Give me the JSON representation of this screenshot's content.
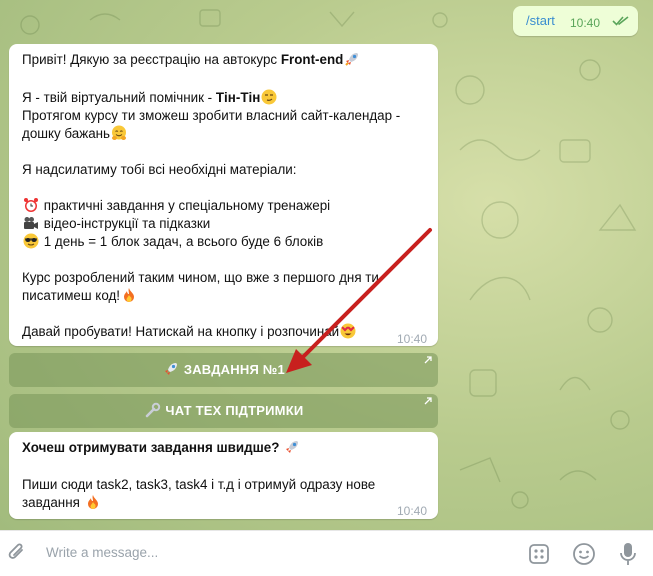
{
  "outgoing": {
    "text": "/start",
    "time": "10:40"
  },
  "message1": {
    "line_greet_prefix": "Привіт! Дякую за реєстрацію на автокурс ",
    "line_greet_bold": "Front-end",
    "line_assist_prefix": "Я - твій віртуальний помічник - ",
    "line_assist_bold": "Тін-Тін",
    "line_course1": "Протягом курсу ти зможеш зробити власний сайт-календар -",
    "line_course2": "дошку бажань",
    "line_send": "Я надсилатиму тобі всі необхідні матеріали:",
    "item1": "практичні завдання у спеціальному тренажері",
    "item2": "відео-інструкції та підказки",
    "item3": "1 день = 1 блок задач, а всього буде 6 блоків",
    "line_built1": "Курс розроблений таким чином, що вже з першого дня ти",
    "line_built2": "писатимеш код!",
    "line_try": "Давай пробувати! Натискай на кнопку і розпочинай",
    "time": "10:40"
  },
  "buttons": {
    "task1": "ЗАВДАННЯ №1",
    "support": "ЧАТ ТЕХ ПІДТРИМКИ"
  },
  "message2": {
    "title": "Хочеш отримувати завдання швидше?",
    "line1": "Пиши сюди task2, task3, task4 і т.д і отримуй одразу нове",
    "line2": "завдання",
    "time": "10:40"
  },
  "composer": {
    "placeholder": "Write a message..."
  },
  "icons": {
    "rocket": "rocket-icon",
    "smirk": "smirk-emoji",
    "hug": "hugging-emoji",
    "clock": "alarm-clock-icon",
    "camera": "movie-camera-icon",
    "sunglasses": "sunglasses-emoji",
    "fire": "fire-emoji",
    "hearteyes": "heart-eyes-emoji",
    "wrench": "wrench-icon"
  },
  "colors": {
    "accent": "#3a8dd0",
    "arrow": "#c8201e",
    "button": "#7f9a62"
  }
}
